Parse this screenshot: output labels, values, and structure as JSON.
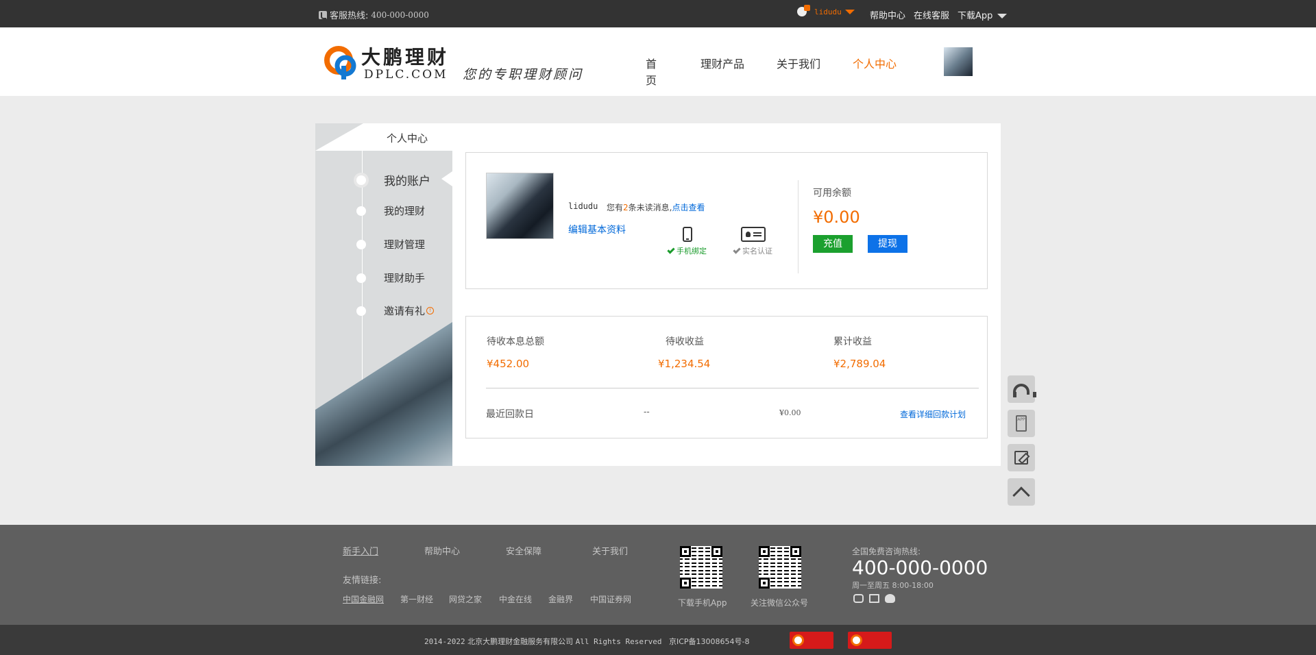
{
  "topbar": {
    "hotline_label": "客服热线:",
    "hotline_number": "400-000-0000",
    "username": "lidudu",
    "links": [
      "帮助中心",
      "在线客服",
      "下载App"
    ]
  },
  "header": {
    "brand_cn": "大鹏理财",
    "brand_en": "DPLC.COM",
    "slogan": "您的专职理财顾问",
    "nav": [
      "首页",
      "理财产品",
      "关于我们",
      "个人中心"
    ],
    "active_nav": "个人中心"
  },
  "sidebar": {
    "title": "个人中心",
    "items": [
      "我的账户",
      "我的理财",
      "理财管理",
      "理财助手",
      "邀请有礼"
    ],
    "active": "我的账户"
  },
  "account": {
    "username": "lidudu",
    "msg_prefix": "您有",
    "msg_count": "2",
    "msg_suffix": "条未读消息,",
    "msg_link": "点击查看",
    "edit_link": "编辑基本资料",
    "phone_bind": "手机绑定",
    "realname": "实名认证",
    "balance_label": "可用余额",
    "balance_value": "¥0.00",
    "recharge": "充值",
    "withdraw": "提现"
  },
  "stats": {
    "items": [
      {
        "label": "待收本息总额",
        "value": "¥452.00"
      },
      {
        "label": "待收收益",
        "value": "¥1,234.54"
      },
      {
        "label": "累计收益",
        "value": "¥2,789.04"
      }
    ],
    "recent_label": "最近回款日",
    "recent_date": "--",
    "recent_amount": "¥0.00",
    "recent_link": "查看详细回款计划"
  },
  "footer": {
    "links": [
      "新手入门",
      "帮助中心",
      "安全保障",
      "关于我们"
    ],
    "friend_title": "友情链接:",
    "friends": [
      "中国金融网",
      "第一财经",
      "网贷之家",
      "中金在线",
      "金融界",
      "中国证券网"
    ],
    "qr_captions": [
      "下载手机App",
      "关注微信公众号"
    ],
    "hotline_label": "全国免费咨询热线:",
    "hotline_number": "400-000-0000",
    "hours": "周一至周五 8:00-18:00",
    "copyright_years": "2014-2022",
    "company": "北京大鹏理财金融服务有限公司",
    "rights": "All Rights Reserved",
    "icp": "京ICP备13008654号-8"
  },
  "colors": {
    "accent": "#f26c00",
    "link": "#0068d9",
    "green": "#1ba02e",
    "blue": "#0d72e8"
  }
}
